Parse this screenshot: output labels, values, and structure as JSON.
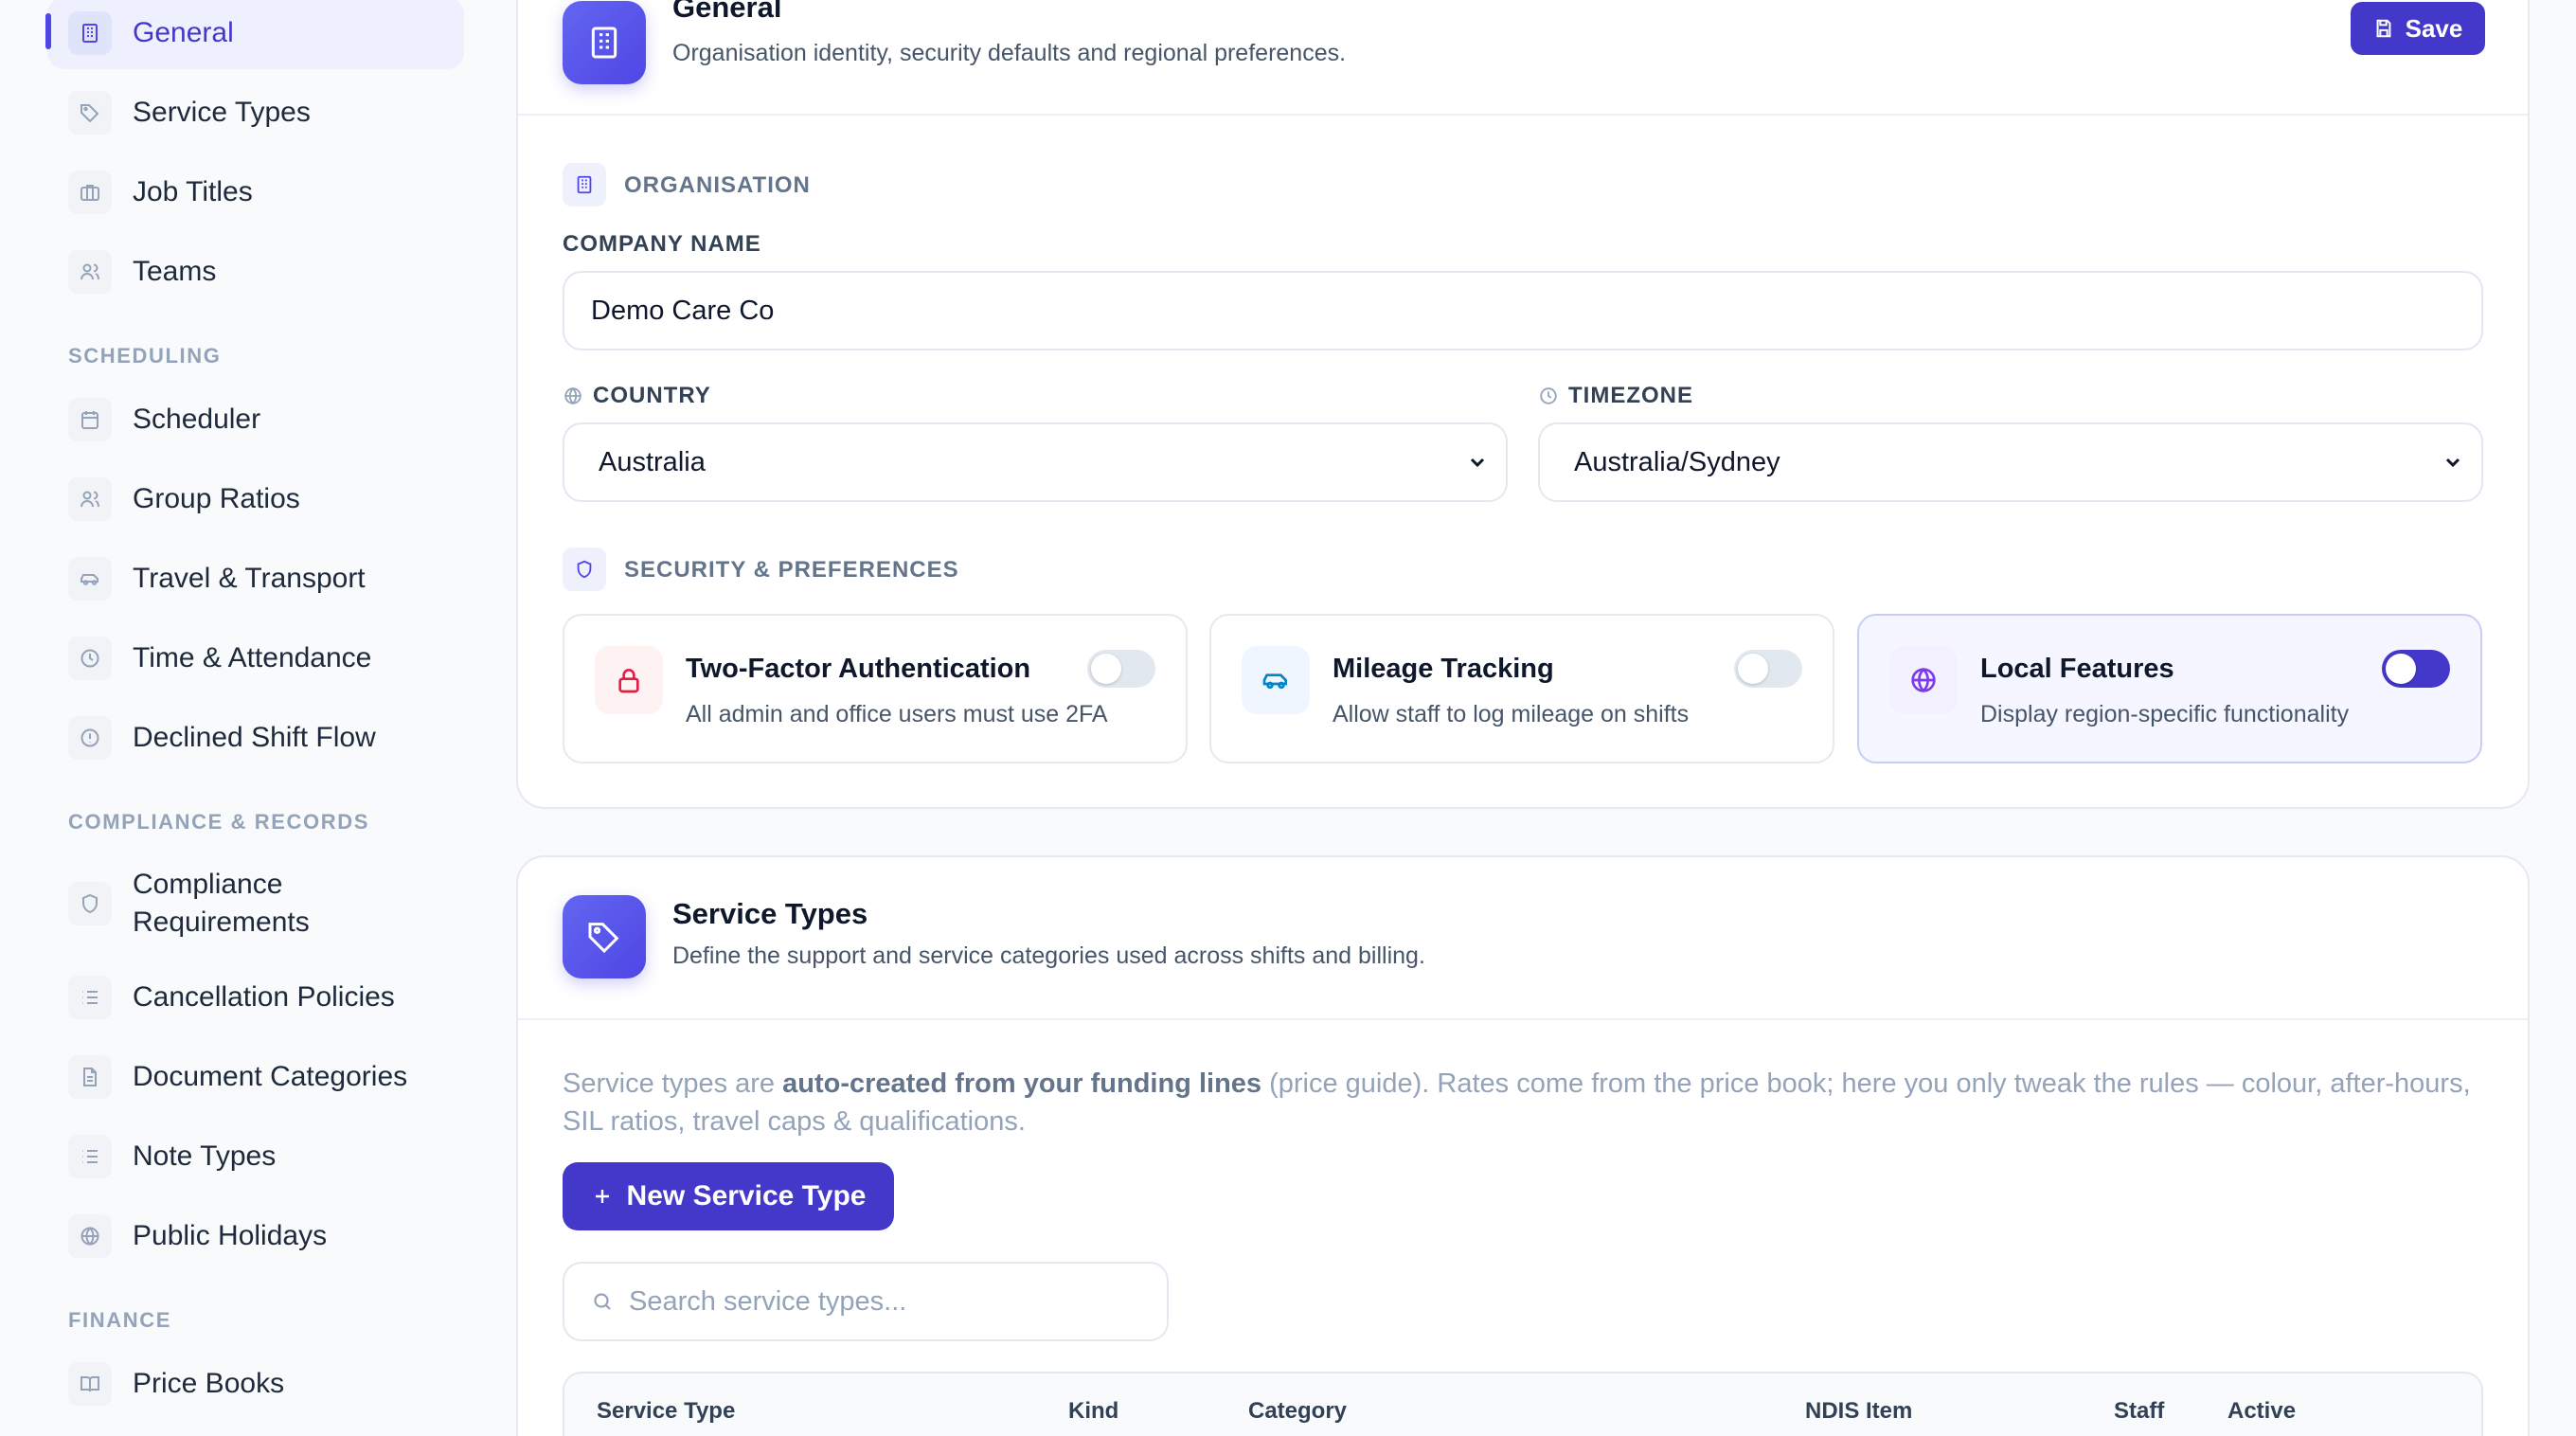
{
  "sidebar": {
    "top_items": [
      {
        "label": "General",
        "icon": "building-icon",
        "active": true
      },
      {
        "label": "Service Types",
        "icon": "tag-icon"
      },
      {
        "label": "Job Titles",
        "icon": "briefcase-icon"
      },
      {
        "label": "Teams",
        "icon": "users-icon"
      }
    ],
    "sections": [
      {
        "title": "SCHEDULING"
      },
      {
        "title": "COMPLIANCE & RECORDS"
      },
      {
        "title": "FINANCE"
      }
    ],
    "scheduling_items": [
      {
        "label": "Scheduler",
        "icon": "calendar-icon"
      },
      {
        "label": "Group Ratios",
        "icon": "users-icon"
      },
      {
        "label": "Travel & Transport",
        "icon": "car-icon"
      },
      {
        "label": "Time & Attendance",
        "icon": "clock-icon"
      },
      {
        "label": "Declined Shift Flow",
        "icon": "alert-circle-icon"
      }
    ],
    "compliance_items": [
      {
        "label": "Compliance",
        "label2": "Requirements",
        "icon": "shield-icon"
      },
      {
        "label": "Cancellation Policies",
        "icon": "list-icon"
      },
      {
        "label": "Document Categories",
        "icon": "file-icon"
      },
      {
        "label": "Note Types",
        "icon": "list-icon"
      },
      {
        "label": "Public Holidays",
        "icon": "globe-icon"
      }
    ],
    "finance_items": [
      {
        "label": "Price Books",
        "icon": "book-icon"
      }
    ]
  },
  "general": {
    "title": "General",
    "subtitle": "Organisation identity, security defaults and regional preferences.",
    "save_label": "Save",
    "organisation_label": "ORGANISATION",
    "company_name_label": "COMPANY NAME",
    "company_name_value": "Demo Care Co",
    "country_label": "COUNTRY",
    "country_value": "Australia",
    "timezone_label": "TIMEZONE",
    "timezone_value": "Australia/Sydney",
    "security_label": "SECURITY & PREFERENCES",
    "toggles": [
      {
        "title": "Two-Factor Authentication",
        "desc": "All admin and office users must use 2FA",
        "on": false,
        "icon": "lock-icon"
      },
      {
        "title": "Mileage Tracking",
        "desc": "Allow staff to log mileage on shifts",
        "on": false,
        "icon": "car-icon"
      },
      {
        "title": "Local Features",
        "desc": "Display region-specific functionality",
        "on": true,
        "icon": "globe-icon"
      }
    ]
  },
  "service_types": {
    "title": "Service Types",
    "subtitle": "Define the support and service categories used across shifts and billing.",
    "info_prefix": "Service types are ",
    "info_bold": "auto-created from your funding lines",
    "info_suffix": " (price guide). Rates come from the price book; here you only tweak the rules — colour, after-hours, SIL ratios, travel caps & qualifications.",
    "new_button_label": "New Service Type",
    "search_placeholder": "Search service types...",
    "columns": [
      "Service Type",
      "Kind",
      "Category",
      "NDIS Item",
      "Staff",
      "Active"
    ]
  },
  "colors": {
    "accent": "#4338ca",
    "accent_light": "#eef0fd",
    "text": "#0f172a",
    "muted": "#94a3b8",
    "danger_tint": "#fef2f2",
    "sky_tint": "#eff6ff",
    "violet_tint": "#f3f0ff"
  }
}
